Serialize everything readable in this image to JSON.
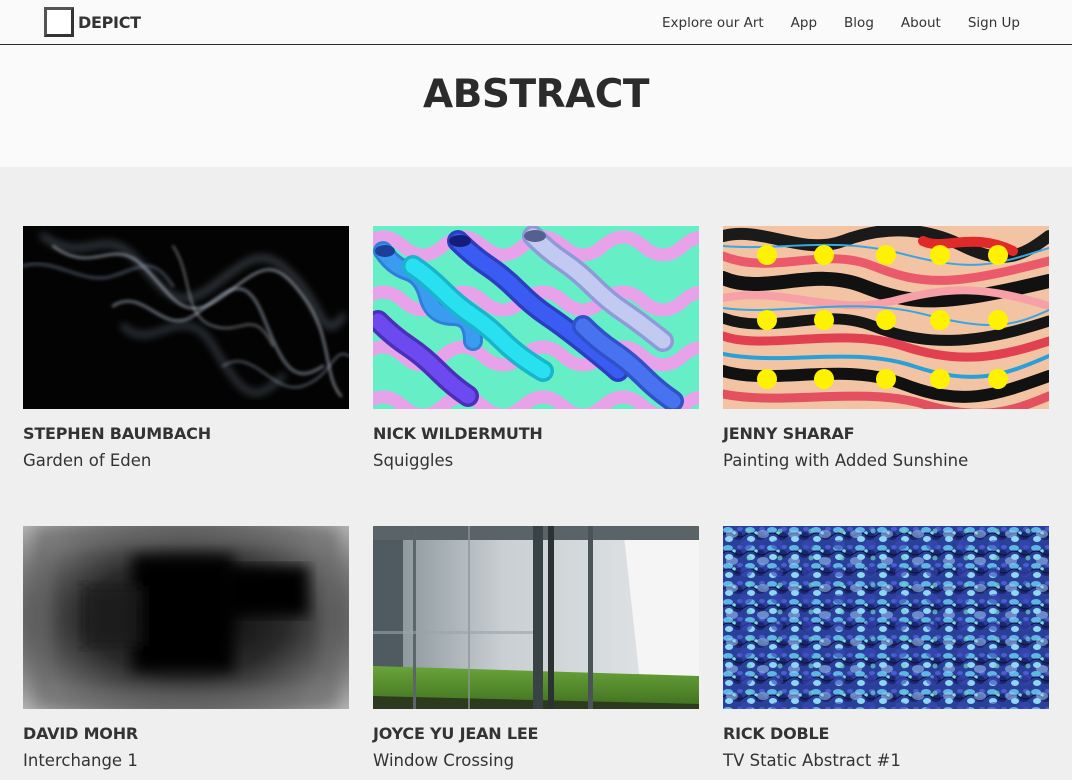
{
  "brand": {
    "name": "DEPICT"
  },
  "nav": [
    "Explore our Art",
    "App",
    "Blog",
    "About",
    "Sign Up"
  ],
  "page": {
    "heading": "ABSTRACT"
  },
  "artworks": [
    {
      "artist": "STEPHEN BAUMBACH",
      "title": "Garden of Eden"
    },
    {
      "artist": "NICK WILDERMUTH",
      "title": "Squiggles"
    },
    {
      "artist": "JENNY SHARAF",
      "title": "Painting with Added Sunshine"
    },
    {
      "artist": "DAVID MOHR",
      "title": "Interchange 1"
    },
    {
      "artist": "JOYCE YU JEAN LEE",
      "title": "Window Crossing"
    },
    {
      "artist": "RICK DOBLE",
      "title": "TV Static Abstract #1"
    }
  ]
}
